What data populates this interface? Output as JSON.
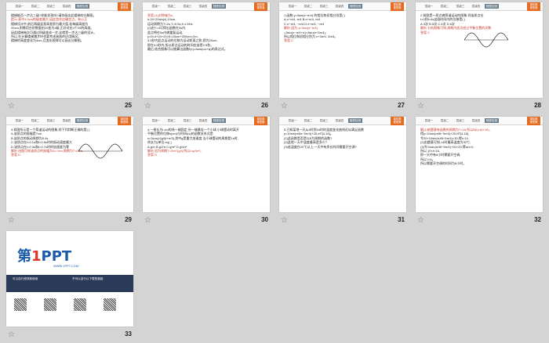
{
  "slide_tabs": [
    "层级一",
    "层级二",
    "层级三",
    "层级四",
    "随堂检测"
  ],
  "corner_label": [
    "课前篇",
    "课堂篇"
  ],
  "slides": [
    {
      "num": "25",
      "lines": [
        "   楼梯能否一步达三级?你能发现吗?请你画出此楼梯的分解图。",
        "提示:表中4.0cm的级差最大,因此首先应确定点。有公正",
        "楼梯设计中,前后两级竖直高差即为最大值,若每级高度为",
        "20cm,则需用台阶数量由20变为4级,正好对应4个20的高度。",
        "因此楼梯每次可通过四级变成一步,这就是一步达三级的设计。",
        "所以,在计算楼梯踏步时也要考虑具体的应用情况。",
        "楼梯的高度变化为4cm,且变化规律可以画出分解图。"
      ],
      "red": [
        1
      ]
    },
    {
      "num": "26",
      "lines": [
        "答案 (1)对称轴为x,",
        "h:24+20sin(x),10cm,",
        "运动周期为T=2s,T=0.5s,f=1.5Hz,",
        "(2)由T=4可得出函数在3s内,",
        "此点将在5s内做重复运动,",
        "y=5×4+24+20×5=20cm+200cm=2m,",
        "3.5秒内此点运动的位移为运动距离之和,即为20cm,",
        "即在3.5秒内,所以质点运动的时间应该是2.5秒。",
        "最后,结合图像可以推算出函数f(x)=Asin(ωx+φ)的表达式。"
      ],
      "red": [
        0
      ]
    },
    {
      "num": "27",
      "lines": [
        "1.函数 y=3sin(x−π/4) 的相位和初相分别是(    )",
        "A.x−π/4, π/4    B.x+π/4, π/4",
        "C.x−π/4, −π/4   D.x+π/4, −π/4",
        "解析 因为 y=3sin(x−π/4)",
        "=3sin(x−π/4+π)=3sin(x+3π/4),",
        "所以相位和初相分别为 x+3π/4, 3π/4。",
        "答案 C"
      ],
      "red": [
        3,
        6
      ]
    },
    {
      "num": "28",
      "lines": [
        "2.如图是一质点做简谐运动的图象,则该质点在",
        "t=0到t=4s这段时间内的位移是(    )",
        "",
        "",
        "",
        "A.3次  B.5次  C.4次  D.6次",
        "解析 分析图象可知,周期内质点经过平衡位置的次数",
        "答案 C"
      ],
      "red": [
        6,
        7
      ],
      "wave": true
    },
    {
      "num": "29",
      "lines": [
        "3.如图所示是一个简谐运动的图象,则下列判断正确的是(    )",
        "A.该质点的振幅是7cm",
        "B.该质点的振动周期为0.4s",
        "C.该质点在t=0.1s和t=0.5s时的振动速度最大",
        "D.该质点在t=0.3s和t=0.7s时的加速度为零",
        "解析 由图可知该质点的振幅为A=7cm,周期为T=0.8s,",
        "答案 D"
      ],
      "red": [
        5,
        6
      ],
      "wave": true
    },
    {
      "num": "30",
      "lines": [
        "4.一根长为l cm的线一端固定,另一端悬挂一个小球,小球摆动时离开",
        "平衡位置的位移s(cm)与时间t(s)的函数关系式是",
        "s=3cos(√(g/l)t+π/3),其中g是重力加速度,当小球摆动的周期是1s时,",
        "线长为(单位:m)(    )",
        "A.g/π    B.g/2π    C.g/π²    D.g/4π²",
        "解析 因为周期T=2π/√(g/l),所以l=g/4π²。",
        "答案 D"
      ],
      "red": [
        5,
        6
      ]
    },
    {
      "num": "31",
      "lines": [
        "",
        "",
        "5.已知某地一天从4时到16时的温度变化曲线近似满足函数",
        "y=10sin(π/8x−5π/4)+20,x∈[4,16]。",
        "(1)此函数是否是以8为周期的函数?",
        "(2)此地一天中温度最高是多少?",
        "(3)若温度在20℃以上,一天中有多长时间需要开空调?",
        ""
      ],
      "red": []
    },
    {
      "num": "32",
      "lines": [
        "解(1)依题意有函数的周期为T=16,所以B(t)=f(t+16),",
        "得y=10sin(π/8t−5π/4)+20,t∈[4,16],",
        "令20+10sin(π/8t−5π/4)=30,得t=14,",
        "(2)由题意可知,14时最高温度为30℃,",
        "(3)令10sin(π/8t−5π/4)+20>20,得sin>0,",
        "所以 10<t<16,",
        "即一天中有6小时需要开空调,",
        "所以 t=6。",
        "所以需要开空调的时间为6小时。"
      ],
      "red": [
        0
      ]
    },
    {
      "num": "33",
      "ppt": true,
      "logo_a": "第",
      "logo_b": "1",
      "logo_c": "PPT",
      "sub": "WWW.1PPT.COM",
      "band_left": "可以自行修改和使用",
      "band_right": "不可以自行以下载的链接"
    }
  ]
}
